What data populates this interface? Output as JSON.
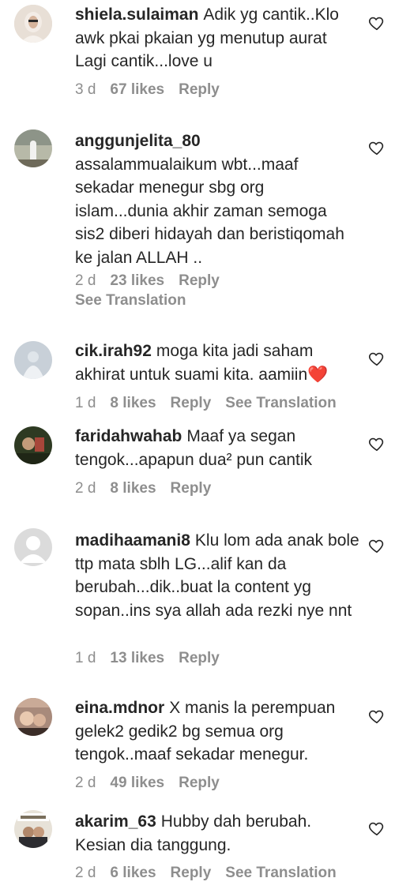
{
  "comments": [
    {
      "username": "shiela.sulaiman",
      "text": "Adik yg cantik..Klo awk pkai pkaian yg menutup aurat Lagi cantik...love u",
      "time": "3 d",
      "likes": "67 likes",
      "reply": "Reply",
      "avatar_color": "#d9c9bd"
    },
    {
      "username": "anggunjelita_80",
      "text": "assalammualaikum wbt...maaf sekadar menegur sbg org islam...dunia akhir zaman semoga sis2 diberi hidayah dan beristiqomah ke jalan ALLAH ..",
      "time": "2 d",
      "likes": "23 likes",
      "reply": "Reply",
      "see_translation": "See Translation",
      "avatar_color": "#9aa294"
    },
    {
      "username": "cik.irah92",
      "text": "moga kita jadi saham akhirat untuk suami kita. aamiin",
      "emoji": "❤️",
      "time": "1 d",
      "likes": "8 likes",
      "reply": "Reply",
      "see_translation": "See Translation",
      "avatar_color": "#b9c4cd"
    },
    {
      "username": "faridahwahab",
      "text": "Maaf ya segan tengok...apapun dua² pun cantik",
      "time": "2 d",
      "likes": "8 likes",
      "reply": "Reply",
      "avatar_color": "#3d4a2c"
    },
    {
      "username": "madihaamani8",
      "text": "Klu lom ada anak bole ttp mata sblh LG...alif kan da berubah...dik..buat la content yg sopan..ins sya allah ada rezki nye nnt",
      "time": "1 d",
      "likes": "13 likes",
      "reply": "Reply",
      "avatar_color": "#dbdbdb"
    },
    {
      "username": "eina.mdnor",
      "text": "X manis la perempuan gelek2 gedik2 bg semua org tengok..maaf sekadar menegur.",
      "time": "2 d",
      "likes": "49 likes",
      "reply": "Reply",
      "avatar_color": "#b0948a"
    },
    {
      "username": "akarim_63",
      "text": "Hubby dah berubah. Kesian dia tanggung.",
      "time": "2 d",
      "likes": "6 likes",
      "reply": "Reply",
      "see_translation": "See Translation",
      "avatar_color": "#c7c1b6"
    }
  ],
  "icons": {
    "like": "heart-outline-icon"
  }
}
